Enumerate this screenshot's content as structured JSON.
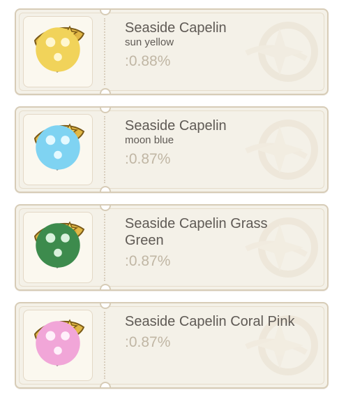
{
  "cards": [
    {
      "item_name": "Seaside Capelin",
      "variant": "sun yellow",
      "rate": ":0.88%",
      "dye_icon": "yellow-dye-icon",
      "dye_color": "#f1d35a"
    },
    {
      "item_name": "Seaside Capelin",
      "variant": "moon blue",
      "rate": ":0.87%",
      "dye_icon": "blue-dye-icon",
      "dye_color": "#7fd3f2"
    },
    {
      "item_name": "Seaside Capelin Grass Green",
      "variant": "",
      "rate": ":0.87%",
      "dye_icon": "green-dye-icon",
      "dye_color": "#3d8b4d"
    },
    {
      "item_name": "Seaside Capelin Coral Pink",
      "variant": "",
      "rate": ":0.87%",
      "dye_icon": "pink-dye-icon",
      "dye_color": "#f1a6d8"
    }
  ],
  "palette": {
    "card_bg": "#f4f1e8",
    "card_border": "#d7ccb7",
    "title_text": "#5f5a55",
    "rate_text": "#c0b6a4"
  }
}
